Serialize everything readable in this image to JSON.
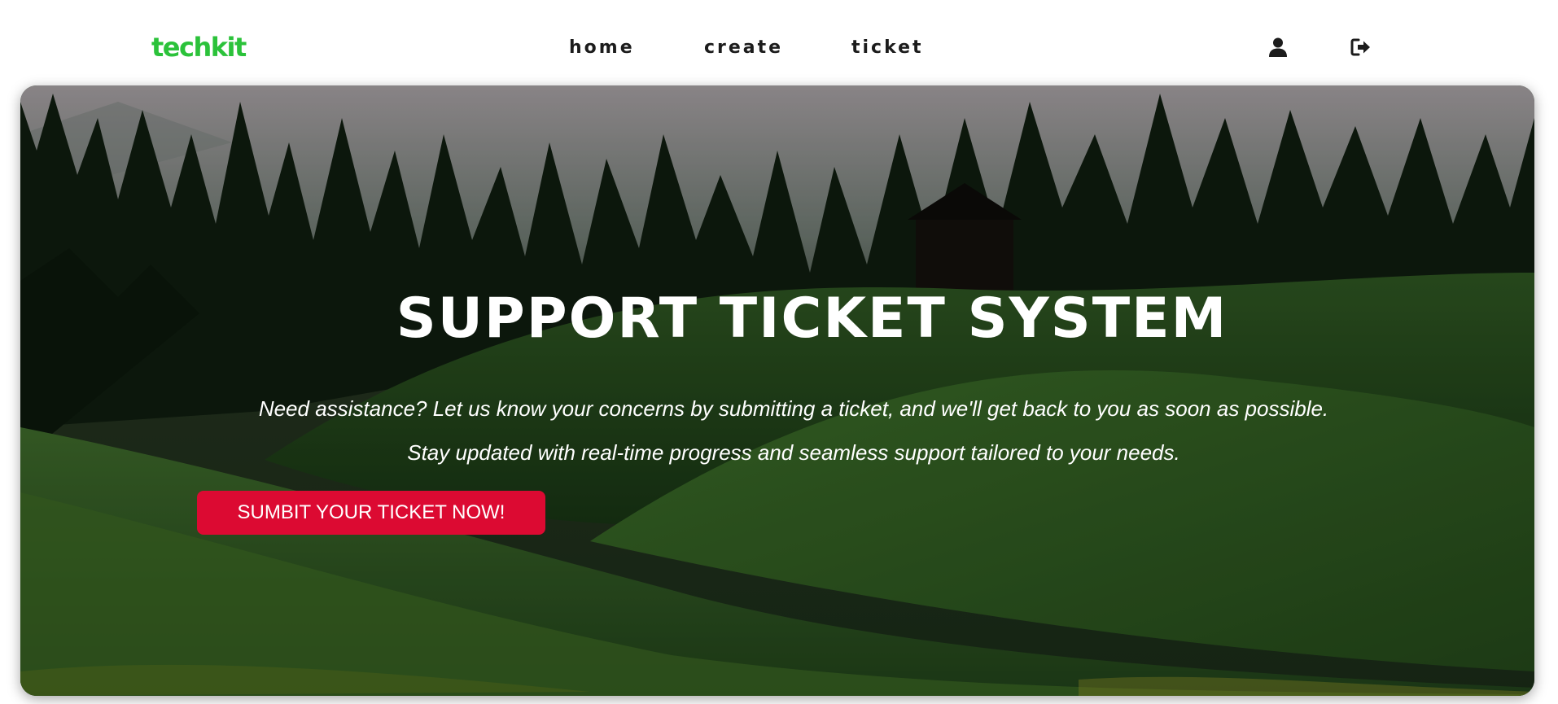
{
  "header": {
    "logo": "techkit",
    "nav": [
      {
        "label": "home"
      },
      {
        "label": "create"
      },
      {
        "label": "ticket"
      }
    ],
    "icons": [
      "user-icon",
      "logout-icon"
    ]
  },
  "hero": {
    "title": "SUPPORT TICKET SYSTEM",
    "line1": "Need assistance? Let us know your concerns by submitting a ticket, and we'll get back to you as soon as possible.",
    "line2": "Stay updated with real-time progress and seamless support tailored to your needs.",
    "cta_label": "SUMBIT YOUR TICKET NOW!"
  },
  "colors": {
    "brand": "#2bc23a",
    "cta": "#dc0a32",
    "nav_text": "#1c1c1c"
  }
}
